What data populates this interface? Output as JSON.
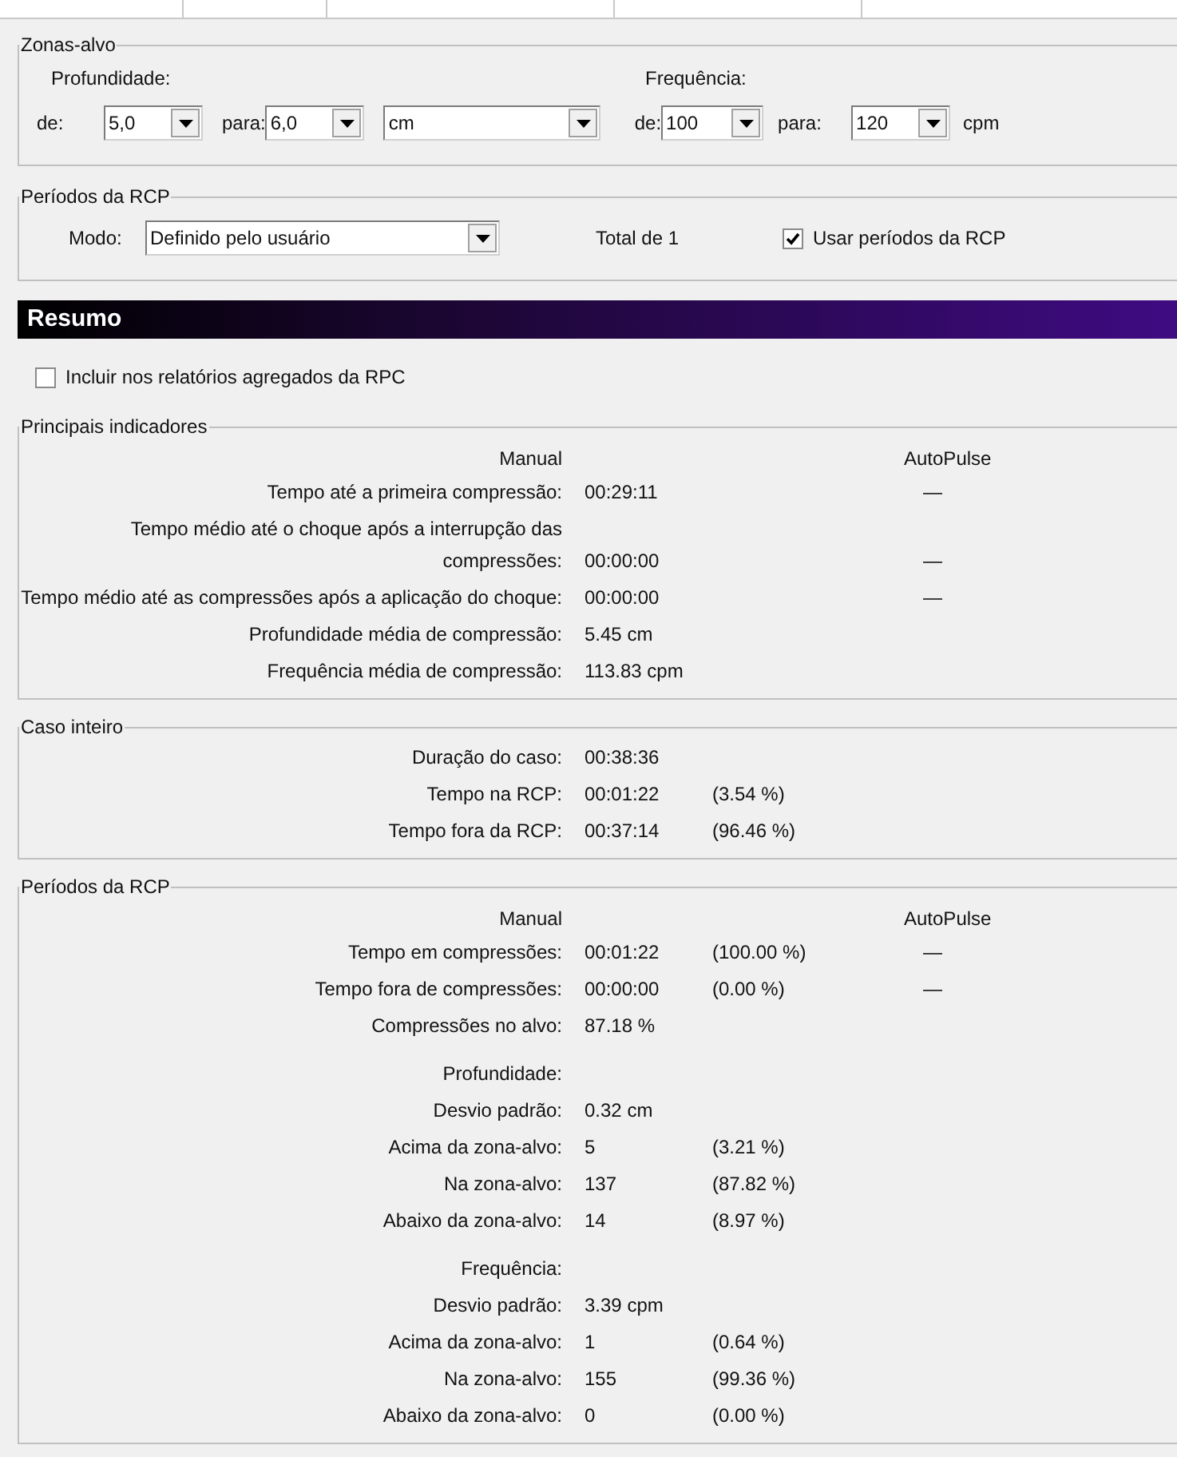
{
  "zonas_alvo": {
    "title": "Zonas-alvo",
    "depth_label": "Profundidade:",
    "freq_label": "Frequência:",
    "controls": [
      {
        "kind": "label",
        "text": "de:"
      },
      {
        "kind": "combo",
        "value": "5,0"
      },
      {
        "kind": "label",
        "text": "para:"
      },
      {
        "kind": "combo",
        "value": "6,0"
      },
      {
        "kind": "combo",
        "value": "cm"
      },
      {
        "kind": "label",
        "text": "de:"
      },
      {
        "kind": "combo",
        "value": "100"
      },
      {
        "kind": "label",
        "text": "para:"
      },
      {
        "kind": "combo",
        "value": "120"
      },
      {
        "kind": "label",
        "text": "cpm"
      }
    ]
  },
  "periodos_config": {
    "title": "Períodos da RCP",
    "mode_label": "Modo:",
    "mode_value": "Definido pelo usuário",
    "total": "Total de 1",
    "use_periods": {
      "label": "Usar períodos da RCP",
      "checked": true
    }
  },
  "resumo": {
    "title": "Resumo",
    "include": {
      "label": "Incluir nos relatórios agregados da RPC",
      "checked": false
    }
  },
  "sections": [
    {
      "title": "Principais indicadores",
      "rows": [
        {
          "kind": "header",
          "manual": "Manual",
          "autopulse": "AutoPulse"
        },
        {
          "kind": "metric",
          "label": "Tempo até a primeira compressão:",
          "manual": "00:29:11",
          "autopulse": "—"
        },
        {
          "kind": "metric",
          "label": "Tempo médio até o choque após a interrupção das compressões:",
          "manual": "00:00:00",
          "autopulse": "—"
        },
        {
          "kind": "metric",
          "label": "Tempo médio até as compressões após a aplicação do choque:",
          "manual": "00:00:00",
          "autopulse": "—"
        },
        {
          "kind": "metric",
          "label": "Profundidade média de compressão:",
          "manual": "5.45 cm"
        },
        {
          "kind": "metric",
          "label": "Frequência média de compressão:",
          "manual": "113.83 cpm"
        }
      ]
    },
    {
      "title": "Caso inteiro",
      "rows": [
        {
          "kind": "metric",
          "label": "Duração do caso:",
          "manual": "00:38:36"
        },
        {
          "kind": "metric",
          "label": "Tempo na RCP:",
          "manual": "00:01:22",
          "percent": "(3.54 %)"
        },
        {
          "kind": "metric",
          "label": "Tempo fora da RCP:",
          "manual": "00:37:14",
          "percent": "(96.46 %)"
        }
      ]
    },
    {
      "title": "Períodos da RCP",
      "rows": [
        {
          "kind": "header",
          "manual": "Manual",
          "autopulse": "AutoPulse"
        },
        {
          "kind": "metric",
          "label": "Tempo em compressões:",
          "manual": "00:01:22",
          "percent": "(100.00 %)",
          "autopulse": "—"
        },
        {
          "kind": "metric",
          "label": "Tempo fora de compressões:",
          "manual": "00:00:00",
          "percent": "(0.00 %)",
          "autopulse": "—"
        },
        {
          "kind": "metric",
          "label": "Compressões no alvo:",
          "manual": "87.18 %"
        },
        {
          "kind": "subheading",
          "label": "Profundidade:"
        },
        {
          "kind": "metric",
          "label": "Desvio padrão:",
          "manual": "0.32 cm"
        },
        {
          "kind": "metric",
          "label": "Acima da zona-alvo:",
          "manual": "5",
          "percent": "(3.21 %)"
        },
        {
          "kind": "metric",
          "label": "Na zona-alvo:",
          "manual": "137",
          "percent": "(87.82 %)"
        },
        {
          "kind": "metric",
          "label": "Abaixo da zona-alvo:",
          "manual": "14",
          "percent": "(8.97 %)"
        },
        {
          "kind": "subheading",
          "label": "Frequência:"
        },
        {
          "kind": "metric",
          "label": "Desvio padrão:",
          "manual": "3.39 cpm"
        },
        {
          "kind": "metric",
          "label": "Acima da zona-alvo:",
          "manual": "1",
          "percent": "(0.64 %)"
        },
        {
          "kind": "metric",
          "label": "Na zona-alvo:",
          "manual": "155",
          "percent": "(99.36 %)"
        },
        {
          "kind": "metric",
          "label": "Abaixo da zona-alvo:",
          "manual": "0",
          "percent": "(0.00 %)"
        }
      ]
    }
  ]
}
